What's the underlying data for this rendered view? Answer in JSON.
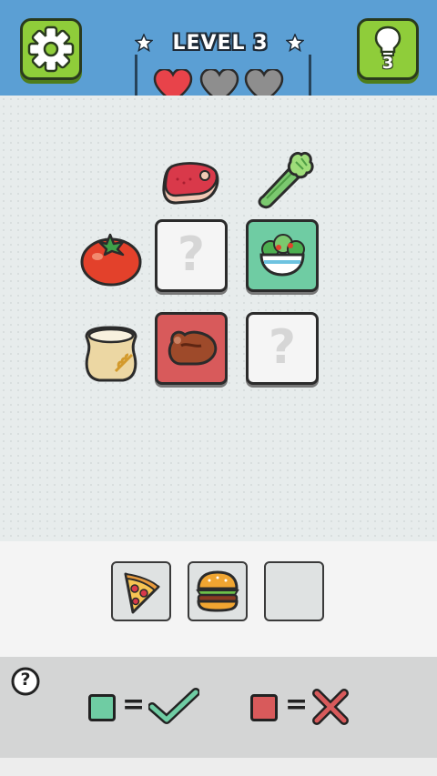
{
  "header": {
    "level_label": "LEVEL 3",
    "hint_count": "3",
    "lives_total": 3,
    "lives_remaining": 1,
    "colors": {
      "header": "#5b9fd4",
      "button": "#8fcd3a",
      "heart_full": "#e8434a",
      "heart_empty": "#8e8e8e"
    }
  },
  "grid": {
    "row_headers": [
      "tomato-icon",
      "flour-sack-icon"
    ],
    "column_headers": [
      "steak-icon",
      "celery-icon"
    ],
    "cells": [
      {
        "state": "unknown",
        "symbol": "?"
      },
      {
        "state": "correct",
        "icon": "salad-bowl-icon"
      },
      {
        "state": "wrong",
        "icon": "grilled-steak-icon"
      },
      {
        "state": "unknown",
        "symbol": "?"
      }
    ]
  },
  "choices": [
    {
      "icon": "pizza-slice-icon"
    },
    {
      "icon": "burger-icon"
    },
    {
      "icon": "empty"
    }
  ],
  "legend": {
    "help_symbol": "?",
    "correct": {
      "color": "#6fcca3",
      "equals": "=",
      "icon": "checkmark-icon"
    },
    "wrong": {
      "color": "#d85a5b",
      "equals": "=",
      "icon": "cross-icon"
    }
  }
}
